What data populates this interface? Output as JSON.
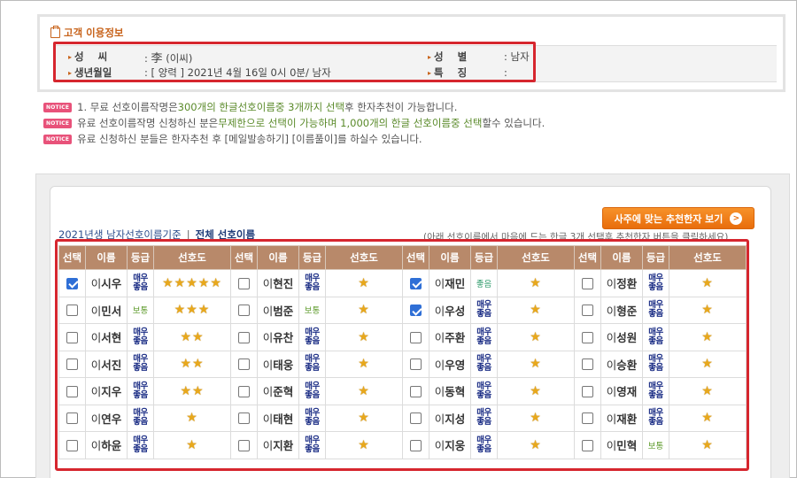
{
  "customer_info": {
    "title": "고객 이용정보",
    "surname_label": "성    씨",
    "surname_value_hanja": "李",
    "surname_value_reading": "(이씨)",
    "gender_label": "성    별",
    "gender_value": "남자",
    "birth_label": "생년월일",
    "birth_value": "[ 양력 ] 2021년 4월 16일 0시 0분/ 남자",
    "feature_label": "특    징",
    "feature_value": ""
  },
  "notices": [
    {
      "badge": "NOTICE",
      "parts": [
        "1. 무료 선호이름작명은 ",
        "300개의 한글선호이름중 3개까지 선택",
        "후 한자추천이 가능합니다."
      ]
    },
    {
      "badge": "NOTICE",
      "parts": [
        "유료 선호이름작명 신청하신 분은",
        "무제한으로 선택이 가능하며 1,000개의 한글 선호이름중 선택",
        "할수 있습니다."
      ]
    },
    {
      "badge": "NOTICE",
      "parts": [
        "유료 신청하신 분들은 한자추천 후 [메일발송하기] [이름풀이]를 하실수 있습니다.",
        "",
        ""
      ]
    }
  ],
  "panel": {
    "recommend_button": "사주에 맞는 추천한자 보기",
    "criteria_link": "2021년생 남자선호이름기준",
    "criteria_sep": "|",
    "criteria_all": "전체 선호이름",
    "hint": "(아래 선호이름에서 마음에 드는 한글 3개 선택후 추천한자 버튼을 클릭하세요)"
  },
  "table": {
    "headers": [
      "선택",
      "이름",
      "등급",
      "선호도"
    ],
    "rows": [
      [
        {
          "checked": true,
          "surname": "이",
          "given": "시우",
          "grade": "매우좋음",
          "grade_type": "best",
          "stars": 5
        },
        {
          "checked": false,
          "surname": "이",
          "given": "현진",
          "grade": "매우좋음",
          "grade_type": "best",
          "stars": 1
        },
        {
          "checked": true,
          "surname": "이",
          "given": "재민",
          "grade": "좋음",
          "grade_type": "good",
          "stars": 1
        },
        {
          "checked": false,
          "surname": "이",
          "given": "정환",
          "grade": "매우좋음",
          "grade_type": "best",
          "stars": 1
        }
      ],
      [
        {
          "checked": false,
          "surname": "이",
          "given": "민서",
          "grade": "보통",
          "grade_type": "normal",
          "stars": 3
        },
        {
          "checked": false,
          "surname": "이",
          "given": "범준",
          "grade": "보통",
          "grade_type": "normal",
          "stars": 1
        },
        {
          "checked": true,
          "surname": "이",
          "given": "우성",
          "grade": "매우좋음",
          "grade_type": "best",
          "stars": 1
        },
        {
          "checked": false,
          "surname": "이",
          "given": "형준",
          "grade": "매우좋음",
          "grade_type": "best",
          "stars": 1
        }
      ],
      [
        {
          "checked": false,
          "surname": "이",
          "given": "서현",
          "grade": "매우좋음",
          "grade_type": "best",
          "stars": 2
        },
        {
          "checked": false,
          "surname": "이",
          "given": "유찬",
          "grade": "매우좋음",
          "grade_type": "best",
          "stars": 1
        },
        {
          "checked": false,
          "surname": "이",
          "given": "주환",
          "grade": "매우좋음",
          "grade_type": "best",
          "stars": 1
        },
        {
          "checked": false,
          "surname": "이",
          "given": "성원",
          "grade": "매우좋음",
          "grade_type": "best",
          "stars": 1
        }
      ],
      [
        {
          "checked": false,
          "surname": "이",
          "given": "서진",
          "grade": "매우좋음",
          "grade_type": "best",
          "stars": 2
        },
        {
          "checked": false,
          "surname": "이",
          "given": "태웅",
          "grade": "매우좋음",
          "grade_type": "best",
          "stars": 1
        },
        {
          "checked": false,
          "surname": "이",
          "given": "우영",
          "grade": "매우좋음",
          "grade_type": "best",
          "stars": 1
        },
        {
          "checked": false,
          "surname": "이",
          "given": "승환",
          "grade": "매우좋음",
          "grade_type": "best",
          "stars": 1
        }
      ],
      [
        {
          "checked": false,
          "surname": "이",
          "given": "지우",
          "grade": "매우좋음",
          "grade_type": "best",
          "stars": 2
        },
        {
          "checked": false,
          "surname": "이",
          "given": "준혁",
          "grade": "매우좋음",
          "grade_type": "best",
          "stars": 1
        },
        {
          "checked": false,
          "surname": "이",
          "given": "동혁",
          "grade": "매우좋음",
          "grade_type": "best",
          "stars": 1
        },
        {
          "checked": false,
          "surname": "이",
          "given": "영재",
          "grade": "매우좋음",
          "grade_type": "best",
          "stars": 1
        }
      ],
      [
        {
          "checked": false,
          "surname": "이",
          "given": "연우",
          "grade": "매우좋음",
          "grade_type": "best",
          "stars": 1
        },
        {
          "checked": false,
          "surname": "이",
          "given": "태현",
          "grade": "매우좋음",
          "grade_type": "best",
          "stars": 1
        },
        {
          "checked": false,
          "surname": "이",
          "given": "지성",
          "grade": "매우좋음",
          "grade_type": "best",
          "stars": 1
        },
        {
          "checked": false,
          "surname": "이",
          "given": "재환",
          "grade": "매우좋음",
          "grade_type": "best",
          "stars": 1
        }
      ],
      [
        {
          "checked": false,
          "surname": "이",
          "given": "하윤",
          "grade": "매우좋음",
          "grade_type": "best",
          "stars": 1
        },
        {
          "checked": false,
          "surname": "이",
          "given": "지환",
          "grade": "매우좋음",
          "grade_type": "best",
          "stars": 1
        },
        {
          "checked": false,
          "surname": "이",
          "given": "지웅",
          "grade": "매우좋음",
          "grade_type": "best",
          "stars": 1
        },
        {
          "checked": false,
          "surname": "이",
          "given": "민혁",
          "grade": "보통",
          "grade_type": "normal",
          "stars": 1
        }
      ]
    ]
  },
  "colors": {
    "accent_orange": "#e86d0c",
    "header_brown": "#b8896a",
    "highlight_red": "#d6262e",
    "notice_pink": "#e8527a",
    "grade_best": "#1d2f86"
  }
}
